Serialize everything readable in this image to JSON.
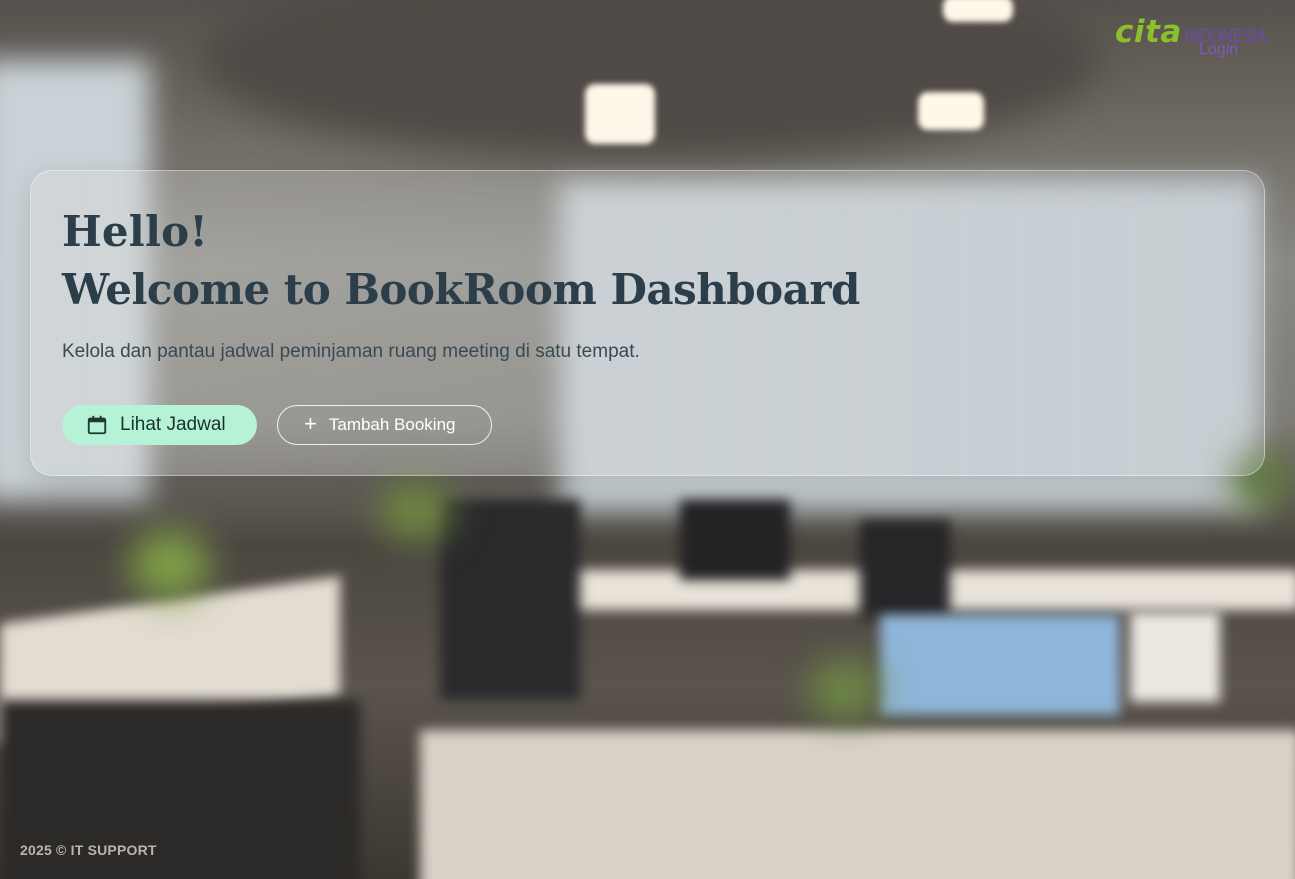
{
  "brand": {
    "logo_text": "cita",
    "logo_suffix": "INDONESIA",
    "login_label": "Login",
    "logo_color": "#8bbf2c",
    "suffix_color": "#6a4bb0"
  },
  "hero": {
    "greeting": "Hello!",
    "title": "Welcome to BookRoom Dashboard",
    "description": "Kelola dan pantau jadwal peminjaman ruang meeting di satu tempat.",
    "primary_button": {
      "label": "Lihat Jadwal",
      "icon": "calendar-icon",
      "color": "#b6f2d6"
    },
    "secondary_button": {
      "label": "Tambah Booking",
      "icon": "plus-icon"
    }
  },
  "footer": {
    "text": "2025 © IT SUPPORT"
  }
}
